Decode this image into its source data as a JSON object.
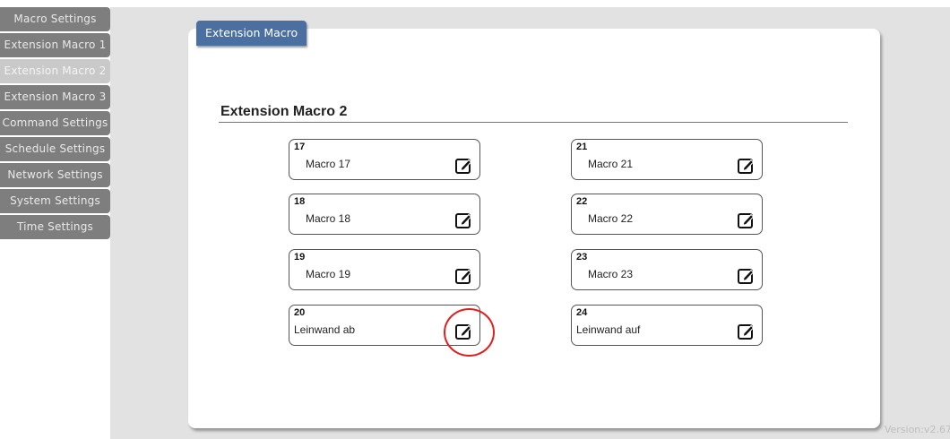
{
  "sidebar": {
    "items": [
      {
        "label": "Macro Settings"
      },
      {
        "label": "Extension Macro 1"
      },
      {
        "label": "Extension Macro 2"
      },
      {
        "label": "Extension Macro 3"
      },
      {
        "label": "Command Settings"
      },
      {
        "label": "Schedule Settings"
      },
      {
        "label": "Network Settings"
      },
      {
        "label": "System Settings"
      },
      {
        "label": "Time Settings"
      }
    ],
    "active_index": 2
  },
  "panel": {
    "tab_label": "Extension Macro",
    "section_title": "Extension Macro 2"
  },
  "macros": [
    {
      "number": "17",
      "name": "Macro 17"
    },
    {
      "number": "18",
      "name": "Macro 18"
    },
    {
      "number": "19",
      "name": "Macro 19"
    },
    {
      "number": "20",
      "name": "Leinwand ab"
    },
    {
      "number": "21",
      "name": "Macro 21"
    },
    {
      "number": "22",
      "name": "Macro 22"
    },
    {
      "number": "23",
      "name": "Macro 23"
    },
    {
      "number": "24",
      "name": "Leinwand auf"
    }
  ],
  "version": "Version:v2.67",
  "colors": {
    "nav_bg": "#7e7e7e",
    "nav_active_bg": "#c9c9c9",
    "tab_bg": "#4a6fa0",
    "highlight_circle": "#e02020"
  },
  "icons": {
    "edit": "edit-icon"
  }
}
